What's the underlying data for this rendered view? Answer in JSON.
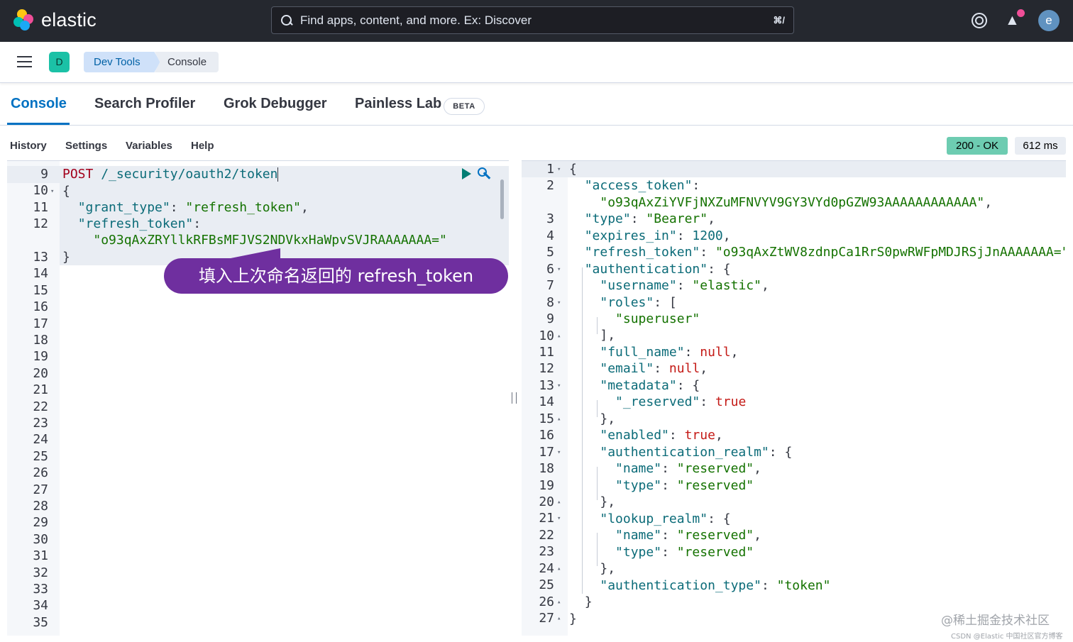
{
  "header": {
    "brand": "elastic",
    "search_placeholder": "Find apps, content, and more. Ex: Discover",
    "search_shortcut": "⌘/",
    "avatar_initial": "e",
    "colors": {
      "bg": "#25282f",
      "notification": "#f04e98",
      "avatar": "#6092c0"
    }
  },
  "breadcrumb": {
    "space_initial": "D",
    "items": [
      "Dev Tools",
      "Console"
    ]
  },
  "tabs": [
    {
      "label": "Console",
      "active": true
    },
    {
      "label": "Search Profiler",
      "active": false
    },
    {
      "label": "Grok Debugger",
      "active": false
    },
    {
      "label": "Painless Lab",
      "active": false
    }
  ],
  "beta_badge": "BETA",
  "toolbar": {
    "items": [
      "History",
      "Settings",
      "Variables",
      "Help"
    ],
    "status": "200 - OK",
    "duration": "612 ms"
  },
  "request_editor": {
    "line_numbers": [
      "9",
      "10",
      "11",
      "12",
      "",
      "13",
      "14",
      "15",
      "16",
      "17",
      "18",
      "19",
      "20",
      "21",
      "22",
      "23",
      "24",
      "25",
      "26",
      "27",
      "28",
      "29",
      "30",
      "31",
      "32",
      "33",
      "34",
      "35"
    ],
    "method": "POST",
    "path": "/_security/oauth2/token",
    "lines": {
      "l10": "{",
      "l11_key": "\"grant_type\"",
      "l11_val": "\"refresh_token\"",
      "l12_key": "\"refresh_token\"",
      "l12_val": "\"o93qAxZRYllkRFBsMFJVS2NDVkxHaWpvSVJRAAAAAAA=\"",
      "l13": "}"
    }
  },
  "response_editor": {
    "line_numbers": [
      "1",
      "2",
      "",
      "3",
      "4",
      "5",
      "6",
      "7",
      "8",
      "9",
      "10",
      "11",
      "12",
      "13",
      "14",
      "15",
      "16",
      "17",
      "18",
      "19",
      "20",
      "21",
      "22",
      "23",
      "24",
      "25",
      "26",
      "27"
    ],
    "code": {
      "access_token_key": "\"access_token\"",
      "access_token_val": "\"o93qAxZiYVFjNXZuMFNVYV9GY3VYd0pGZW93AAAAAAAAAAAA\"",
      "type_key": "\"type\"",
      "type_val": "\"Bearer\"",
      "expires_key": "\"expires_in\"",
      "expires_val": "1200",
      "refresh_key": "\"refresh_token\"",
      "refresh_val": "\"o93qAxZtWV8zdnpCa1RrS0pwRWFpMDJRSjJnAAAAAAA=\"",
      "auth_key": "\"authentication\"",
      "username_key": "\"username\"",
      "username_val": "\"elastic\"",
      "roles_key": "\"roles\"",
      "role_val": "\"superuser\"",
      "full_name_key": "\"full_name\"",
      "email_key": "\"email\"",
      "null_val": "null",
      "metadata_key": "\"metadata\"",
      "reserved_key": "\"_reserved\"",
      "true_val": "true",
      "enabled_key": "\"enabled\"",
      "auth_realm_key": "\"authentication_realm\"",
      "name_key": "\"name\"",
      "reserved_val": "\"reserved\"",
      "lookup_realm_key": "\"lookup_realm\"",
      "auth_type_key": "\"authentication_type\"",
      "auth_type_val": "\"token\""
    }
  },
  "annotation": {
    "text": "填入上次命名返回的 refresh_token",
    "color": "#6f2f9f"
  },
  "watermark": {
    "line1": "@稀土掘金技术社区",
    "line2": "CSDN @Elastic 中国社区官方博客"
  }
}
